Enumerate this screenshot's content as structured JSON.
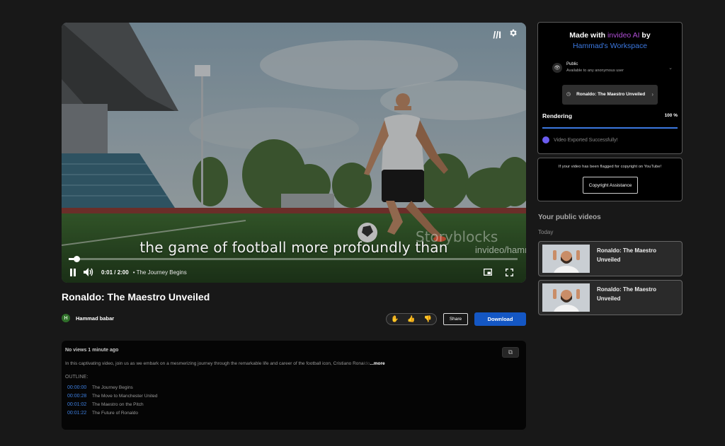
{
  "player": {
    "subtitle": "the game of football more profoundly than",
    "watermark": "Storyblocks",
    "watermark_handle": "invideo/hammad",
    "progress": 0.0167,
    "current_time": "0:01",
    "duration": "2:00",
    "time_separator": " / ",
    "chapter_prefix": "•",
    "current_chapter": "The Journey Begins",
    "icons": {
      "brand_mark": "//I",
      "settings": "gear-icon",
      "play_pause": "pause-icon",
      "volume": "volume-icon",
      "pip": "picture-in-picture-icon",
      "fullscreen": "fullscreen-icon"
    }
  },
  "video": {
    "title": "Ronaldo: The Maestro Unveiled",
    "author_initial": "H",
    "author": "Hammad babar",
    "share_label": "Share",
    "download_label": "Download"
  },
  "description": {
    "meta": "No views  1 minute ago",
    "text": "In this captivating video, join us as we embark on a mesmerizing journey through the remarkable life and career of the football icon, Cristiano Rona",
    "faded": "ldo",
    "more_label": "...more",
    "outline_label": "OUTLINE:",
    "outline": [
      {
        "time": "00:00:00",
        "title": "The Journey Begins"
      },
      {
        "time": "00:00:28",
        "title": "The Move to Manchester United"
      },
      {
        "time": "00:01:02",
        "title": "The Maestro on the Pitch"
      },
      {
        "time": "00:01:22",
        "title": "The Future of Ronaldo"
      }
    ]
  },
  "made_with": {
    "prefix": "Made with ",
    "brand": "invideo AI",
    "by": " by",
    "workspace": "Hammad's Workspace",
    "visibility_title": "Public",
    "visibility_sub": "Available to any anonymous user",
    "file_name": "Ronaldo: The Maestro Unveiled",
    "rendering_label": "Rendering",
    "rendering_percent": "100 %",
    "rendering_progress": 1.0,
    "export_status": "Video Exported Successfully!"
  },
  "copyright": {
    "text": "If your video has been flagged for copyright on YouTube!",
    "button_label": "Copyright Assistance"
  },
  "public_videos": {
    "heading": "Your public videos",
    "group_label": "Today",
    "items": [
      {
        "title": "Ronaldo: The Maestro Unveiled"
      },
      {
        "title": "Ronaldo: The Maestro Unveiled"
      }
    ]
  },
  "colors": {
    "background": "#181818",
    "accent_blue": "#1457c4",
    "brand_purple": "#b04ed6",
    "link_blue": "#3b78e0"
  }
}
